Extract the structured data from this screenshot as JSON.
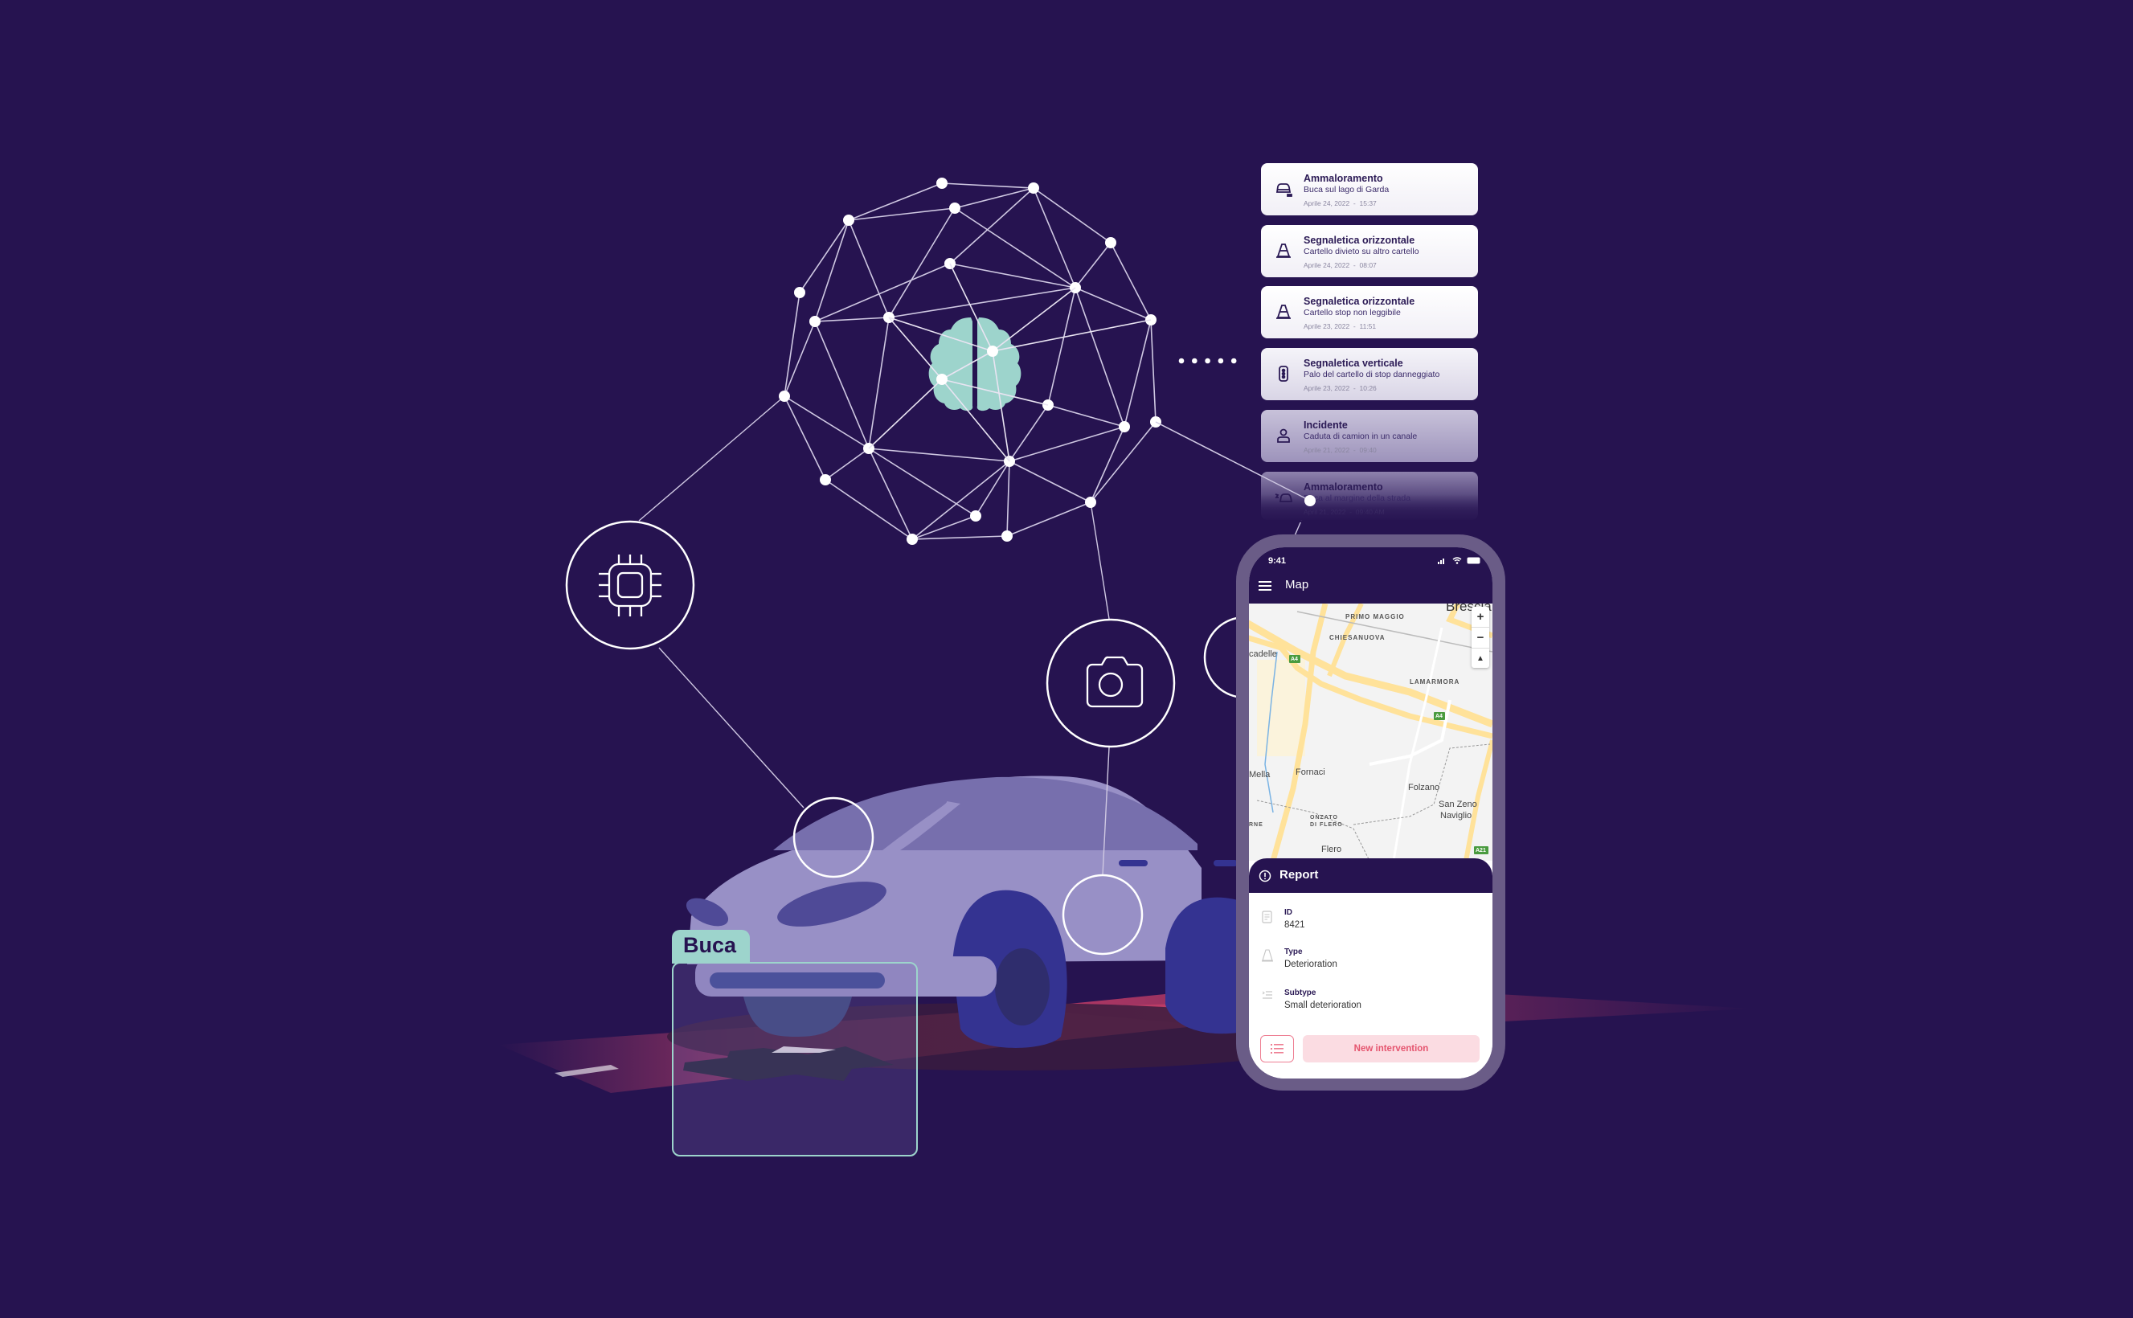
{
  "colors": {
    "background": "#261350",
    "accent_teal": "#9dd4cc",
    "car_body": "#9890c6",
    "car_dark": "#343391",
    "road_pink": "#d0466c",
    "button_pink_bg": "#fbdce2",
    "button_pink_text": "#e5556f"
  },
  "network": {
    "center_icon": "brain-icon",
    "connector_dots": 5
  },
  "feature_icons": [
    {
      "name": "chip-icon",
      "label": "processor"
    },
    {
      "name": "camera-icon",
      "label": "camera"
    }
  ],
  "reports_list": [
    {
      "icon": "damaged-car-icon",
      "title": "Ammaloramento",
      "subtitle": "Buca sul lago di Garda",
      "date": "Aprile 24, 2022",
      "time": "15:37"
    },
    {
      "icon": "traffic-cone-icon",
      "title": "Segnaletica orizzontale",
      "subtitle": "Cartello divieto su altro cartello",
      "date": "Aprile 24, 2022",
      "time": "08:07"
    },
    {
      "icon": "traffic-cone-icon",
      "title": "Segnaletica orizzontale",
      "subtitle": "Cartello stop non leggibile",
      "date": "Aprile 23, 2022",
      "time": "11:51"
    },
    {
      "icon": "traffic-light-icon",
      "title": "Segnaletica verticale",
      "subtitle": "Palo del cartello di stop danneggiato",
      "date": "Aprile 23, 2022",
      "time": "10:26"
    },
    {
      "icon": "person-icon",
      "title": "Incidente",
      "subtitle": "Caduta di camion in un canale",
      "date": "Aprile 21, 2022",
      "time": "09:40"
    },
    {
      "icon": "crash-icon",
      "title": "Ammaloramento",
      "subtitle": "Buca al margine della strada",
      "date": "April 21, 2022",
      "time": "09:40 AM"
    }
  ],
  "date_separator": "-",
  "phone": {
    "status_time": "9:41",
    "app_title": "Map",
    "map_labels": {
      "brescia": "Brescia",
      "primo_maggio": "PRIMO MAGGIO",
      "chiesanuova": "CHIESANUOVA",
      "lamarmora": "LAMARMORA",
      "cadelle": "cadelle",
      "mella": "Mella",
      "fornaci": "Fornaci",
      "folzano": "Folzano",
      "san_zeno": "San Zeno",
      "naviglio": "Naviglio",
      "onzato": "ONZATO",
      "di_flero": "DI FLERO",
      "rne": "RNE",
      "flero": "Flero",
      "a4": "A4",
      "a21": "A21"
    },
    "zoom_in": "+",
    "zoom_out": "−",
    "compass": "▲",
    "report": {
      "title": "Report",
      "fields": [
        {
          "icon": "document-icon",
          "label": "ID",
          "value": "8421"
        },
        {
          "icon": "traffic-cone-icon",
          "label": "Type",
          "value": "Deterioration"
        },
        {
          "icon": "subtype-list-icon",
          "label": "Subtype",
          "value": "Small deterioration"
        }
      ],
      "new_intervention_label": "New intervention"
    }
  },
  "detection": {
    "label": "Buca"
  }
}
